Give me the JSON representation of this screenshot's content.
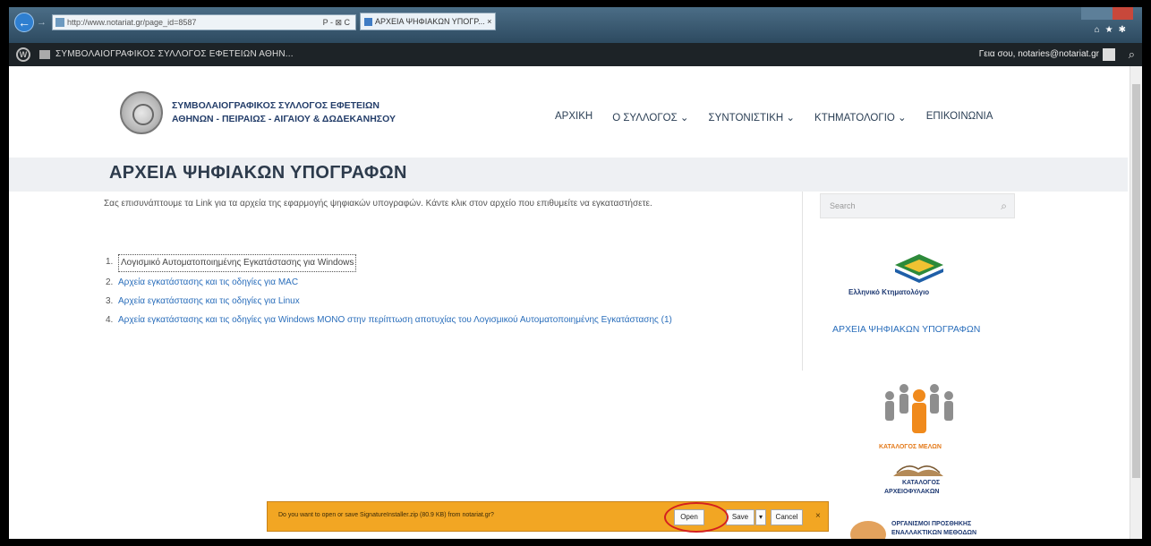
{
  "browser": {
    "address_text": "http://www.notariat.gr/page_id=8587",
    "address_tools": "P - ⊠ C",
    "tab_title": "ΑΡΧΕΙΑ ΨΗΦΙΑΚΩΝ ΥΠΟΓΡ... ×",
    "icons": [
      "back-icon",
      "forward-icon",
      "home-icon",
      "star-icon",
      "gear-icon"
    ]
  },
  "adminbar": {
    "site_name": "ΣΥΜΒΟΛΑΙΟΓΡΑΦΙΚΟΣ ΣΥΛΛΟΓΟΣ ΕΦΕΤΕΙΩΝ ΑΘΗΝ...",
    "greeting": "Γεια σου, notaries@notariat.gr"
  },
  "header": {
    "logo_line1": "ΣΥΜΒΟΛΑΙΟΓΡΑΦΙΚΟΣ ΣΥΛΛΟΓΟΣ ΕΦΕΤΕΙΩΝ",
    "logo_line2": "ΑΘΗΝΩΝ - ΠΕΙΡΑΙΩΣ - ΑΙΓΑΙΟΥ & ΔΩΔΕΚΑΝΗΣΟΥ",
    "nav": [
      "ΑΡΧΙΚΗ",
      "Ο ΣΥΛΛΟΓΟΣ ⌄",
      "ΣΥΝΤΟΝΙΣΤΙΚΗ ⌄",
      "ΚΤΗΜΑΤΟΛΟΓΙΟ ⌄",
      "ΕΠΙΚΟΙΝΩΝΙΑ"
    ]
  },
  "page": {
    "title": "ΑΡΧΕΙΑ ΨΗΦΙΑΚΩΝ ΥΠΟΓΡΑΦΩΝ",
    "intro": "Σας επισυνάπτουμε τα Link για τα αρχεία της εφαρμογής ψηφιακών υπογραφών. Κάντε κλικ στον αρχείο που επιθυμείτε να εγκαταστήσετε.",
    "links": [
      {
        "num": "1.",
        "text": "Λογισμικό Αυτοματοποιημένης Εγκατάστασης για Windows"
      },
      {
        "num": "2.",
        "text": "Αρχεία εγκατάστασης και τις οδηγίες για MAC"
      },
      {
        "num": "3.",
        "text": "Αρχεία εγκατάστασης και τις οδηγίες για Linux"
      },
      {
        "num": "4.",
        "text": "Αρχεία εγκατάστασης και τις οδηγίες για Windows ΜΟΝΟ στην περίπτωση αποτυχίας του Λογισμικού Αυτοματοποιημένης Εγκατάστασης (1)"
      }
    ]
  },
  "sidebar": {
    "search_placeholder": "Search",
    "ktima_label": "Ελληνικό Κτηματολόγιο",
    "side_link": "ΑΡΧΕΙΑ ΨΗΦΙΑΚΩΝ ΥΠΟΓΡΑΦΩΝ",
    "members_label": "ΚΑΤΑΛΟΓΟΣ ΜΕΛΩΝ",
    "archive_label1": "ΚΑΤΑΛΟΓΟΣ",
    "archive_label2": "ΑΡΧΕΙΟΦΥΛΑΚΩΝ",
    "org_label1": "ΟΡΓΑΝΙΣΜΟΙ ΠΡΟΣΘΗΚΗΣ",
    "org_label2": "ΕΝΑΛΛΑΚΤΙΚΩΝ ΜΕΘΟΔΩΝ"
  },
  "download_bar": {
    "message": "Do you want to open or save SignatureInstaller.zip (80.9 KB) from notariat.gr?",
    "open": "Open",
    "save": "Save",
    "save_arrow": "▾",
    "cancel": "Cancel",
    "close": "×"
  },
  "colors": {
    "accent": "#2a6ebb",
    "download_bar": "#f2a623",
    "highlight": "#d42020"
  }
}
